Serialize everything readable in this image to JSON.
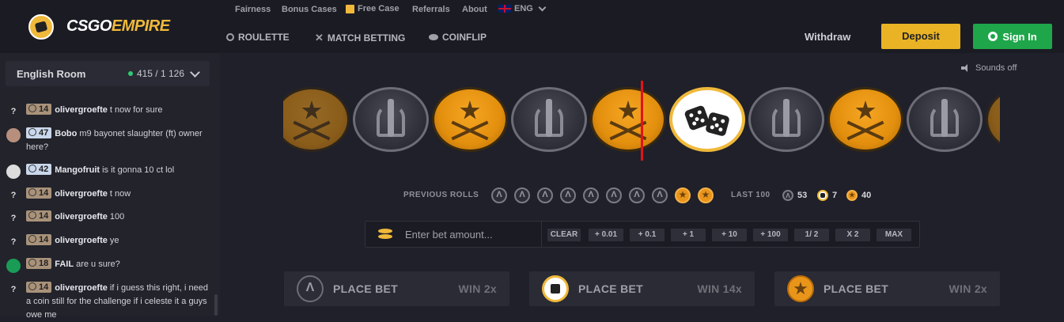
{
  "brand": {
    "part1": "CSGO",
    "part2": "EMPIRE"
  },
  "top_links": [
    {
      "label": "Fairness"
    },
    {
      "label": "Bonus Cases"
    },
    {
      "label": "Free Case"
    },
    {
      "label": "Referrals"
    },
    {
      "label": "About"
    },
    {
      "label": "ENG"
    }
  ],
  "nav": {
    "roulette": "ROULETTE",
    "match_betting": "MATCH BETTING",
    "coinflip": "COINFLIP",
    "withdraw": "Withdraw",
    "deposit": "Deposit",
    "signin": "Sign In"
  },
  "sounds": "Sounds off",
  "chat": {
    "room": "English Room",
    "online": "415 / 1 126",
    "messages": [
      {
        "avatar": "?",
        "level": "14",
        "user": "olivergroefte",
        "text": "t now for sure"
      },
      {
        "avatar": "",
        "level": "47",
        "user": "Bobo",
        "text": "m9 bayonet slaughter (ft) owner here?"
      },
      {
        "avatar": "",
        "level": "42",
        "user": "Mangofruit",
        "text": "is it gonna 10 ct lol"
      },
      {
        "avatar": "?",
        "level": "14",
        "user": "olivergroefte",
        "text": "t now"
      },
      {
        "avatar": "?",
        "level": "14",
        "user": "olivergroefte",
        "text": "100"
      },
      {
        "avatar": "?",
        "level": "14",
        "user": "olivergroefte",
        "text": "ye"
      },
      {
        "avatar": "",
        "level": "18",
        "user": "FAIL",
        "text": "are u sure?"
      },
      {
        "avatar": "?",
        "level": "14",
        "user": "olivergroefte",
        "text": "if i guess this right, i need a coin still for the challenge if i celeste it a guys owe me"
      }
    ]
  },
  "roulette": {
    "previous_label": "PREVIOUS ROLLS",
    "previous": [
      "ct",
      "ct",
      "ct",
      "ct",
      "ct",
      "ct",
      "ct",
      "ct",
      "t",
      "t"
    ],
    "last100_label": "LAST 100",
    "last100": {
      "ct": "53",
      "bonus": "7",
      "t": "40"
    }
  },
  "bet": {
    "placeholder": "Enter bet amount...",
    "buttons": [
      "CLEAR",
      "+ 0.01",
      "+ 0.1",
      "+ 1",
      "+ 10",
      "+ 100",
      "1/ 2",
      "X 2",
      "MAX"
    ]
  },
  "panels": [
    {
      "side": "ct",
      "label": "PLACE BET",
      "win": "WIN 2x"
    },
    {
      "side": "bonus",
      "label": "PLACE BET",
      "win": "WIN 14x"
    },
    {
      "side": "t",
      "label": "PLACE BET",
      "win": "WIN 2x"
    }
  ],
  "colors": {
    "accent": "#e9b325",
    "signin": "#1fa64a",
    "pointer": "#e0131b"
  }
}
